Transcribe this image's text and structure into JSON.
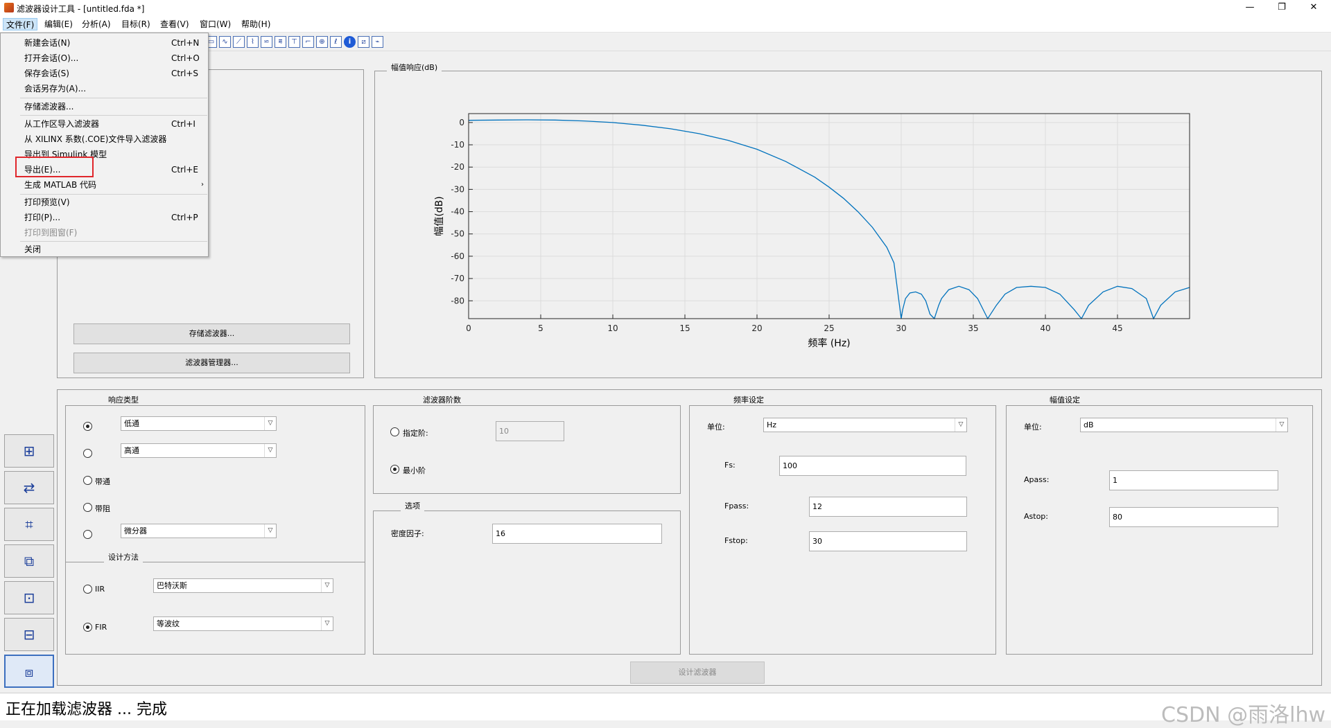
{
  "window": {
    "title": "滤波器设计工具 - [untitled.fda *]",
    "controls": [
      "—",
      "❐",
      "✕"
    ]
  },
  "menus": [
    "文件(F)",
    "编辑(E)",
    "分析(A)",
    "目标(R)",
    "查看(V)",
    "窗口(W)",
    "帮助(H)"
  ],
  "file_menu": {
    "items": [
      {
        "label": "新建会话(N)",
        "shortcut": "Ctrl+N"
      },
      {
        "label": "打开会话(O)...",
        "shortcut": "Ctrl+O"
      },
      {
        "label": "保存会话(S)",
        "shortcut": "Ctrl+S"
      },
      {
        "label": "会话另存为(A)...",
        "shortcut": ""
      },
      {
        "label": "存储滤波器...",
        "shortcut": ""
      },
      {
        "label": "从工作区导入滤波器",
        "shortcut": "Ctrl+I"
      },
      {
        "label": "从 XILINX 系数(.COE)文件导入滤波器",
        "shortcut": ""
      },
      {
        "label": "导出到 Simulink 模型",
        "shortcut": ""
      },
      {
        "label": "导出(E)...",
        "shortcut": "Ctrl+E"
      },
      {
        "label": "生成 MATLAB 代码",
        "shortcut": "",
        "submenu": "›"
      },
      {
        "label": "打印预览(V)",
        "shortcut": ""
      },
      {
        "label": "打印(P)...",
        "shortcut": "Ctrl+P"
      },
      {
        "label": "打印到图窗(F)",
        "shortcut": ""
      },
      {
        "label": "关闭",
        "shortcut": ""
      }
    ]
  },
  "left_panel": {
    "store_filter_button": "存储滤波器...",
    "filter_manager_button": "滤波器管理器..."
  },
  "plot_panel": {
    "title": "幅值响应(dB)"
  },
  "chart_data": {
    "type": "line",
    "xlabel": "频率 (Hz)",
    "ylabel": "幅值(dB)",
    "xlim": [
      0,
      50
    ],
    "ylim": [
      -88,
      4
    ],
    "xticks": [
      0,
      5,
      10,
      15,
      20,
      25,
      30,
      35,
      40,
      45
    ],
    "yticks": [
      0,
      -10,
      -20,
      -30,
      -40,
      -50,
      -60,
      -70,
      -80
    ],
    "grid": true,
    "color": "#0072BD",
    "x": [
      0,
      2,
      4,
      6,
      8,
      10,
      12,
      14,
      16,
      18,
      20,
      22,
      24,
      25,
      26,
      27,
      28,
      29,
      29.5,
      30,
      30.1,
      30.3,
      30.6,
      31,
      31.4,
      31.7,
      32,
      32.3,
      32.6,
      32.8,
      33.3,
      34,
      34.7,
      35.3,
      36,
      36.6,
      37.2,
      38,
      39,
      40,
      41,
      42,
      42.5,
      43,
      44,
      45,
      46,
      47,
      47.5,
      48,
      49,
      50
    ],
    "y": [
      1,
      1.1,
      1.2,
      1.1,
      0.7,
      0,
      -1.2,
      -2.8,
      -5,
      -8,
      -12,
      -17.5,
      -24.5,
      -29,
      -34,
      -40,
      -47,
      -56,
      -63,
      -88,
      -84,
      -79,
      -76.5,
      -76,
      -77,
      -80,
      -86,
      -88,
      -82,
      -79,
      -75,
      -73.5,
      -75,
      -79,
      -88,
      -82,
      -77,
      -74,
      -73.5,
      -74,
      -77,
      -84,
      -88,
      -82,
      -76,
      -73.5,
      -74.5,
      -79,
      -88,
      -82,
      -76,
      -74
    ]
  },
  "response_type": {
    "title": "响应类型",
    "options": [
      {
        "label": "",
        "select": "低通",
        "selected": true
      },
      {
        "label": "",
        "select": "高通",
        "selected": false
      },
      {
        "label": "带通",
        "select": "",
        "selected": false
      },
      {
        "label": "带阻",
        "select": "",
        "selected": false
      },
      {
        "label": "",
        "select": "微分器",
        "selected": false
      }
    ]
  },
  "design_method": {
    "title": "设计方法",
    "iir_label": "IIR",
    "iir_select": "巴特沃斯",
    "fir_label": "FIR",
    "fir_select": "等波纹"
  },
  "filter_order": {
    "title": "滤波器阶数",
    "specify_label": "指定阶:",
    "specify_value": "10",
    "minimum_label": "最小阶"
  },
  "options": {
    "title": "选项",
    "density_label": "密度因子:",
    "density_value": "16"
  },
  "freq_specs": {
    "title": "频率设定",
    "units_label": "单位:",
    "units_value": "Hz",
    "fs_label": "Fs:",
    "fs_value": "100",
    "fpass_label": "Fpass:",
    "fpass_value": "12",
    "fstop_label": "Fstop:",
    "fstop_value": "30"
  },
  "mag_specs": {
    "title": "幅值设定",
    "units_label": "单位:",
    "units_value": "dB",
    "apass_label": "Apass:",
    "apass_value": "1",
    "astop_label": "Astop:",
    "astop_value": "80"
  },
  "design_button": "设计滤波器",
  "status": {
    "text": "正在加载滤波器 ... 完成",
    "watermark": "CSDN @雨洛lhw"
  }
}
